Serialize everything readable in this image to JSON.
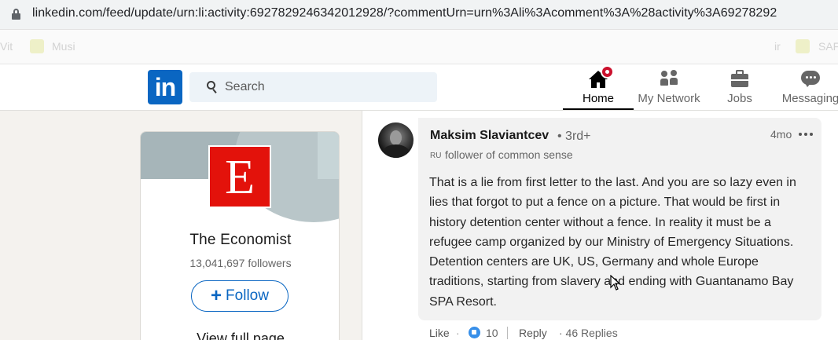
{
  "browser": {
    "url": "linkedin.com/feed/update/urn:li:activity:6927829246342012928/?commentUrn=urn%3Ali%3Acomment%3A%28activity%3A69278292"
  },
  "bookmarks": [
    "Vit",
    "Musi",
    "SAF",
    "ir"
  ],
  "header": {
    "logo": "in",
    "search_placeholder": "Search",
    "nav": [
      {
        "label": "Home"
      },
      {
        "label": "My Network"
      },
      {
        "label": "Jobs"
      },
      {
        "label": "Messaging"
      }
    ]
  },
  "company": {
    "logo_letter": "E",
    "name": "The Economist",
    "followers": "13,041,697 followers",
    "follow_label": "Follow",
    "view_page_label": "View full page"
  },
  "comment": {
    "author": "Maksim Slaviantcev",
    "degree": "• 3rd+",
    "flag": "RU",
    "headline": "follower of common sense",
    "time": "4mo",
    "text": "That is a lie from first letter to the last. And you are so lazy even in lies that forgot to put a fence on a picture. That would be first in history detention center without a fence. In reality it must be a refugee camp organized by our Ministry of Emergency Situations. Detention centers are UK, US, Germany and whole Europe traditions, starting from slavery and ending with Guantanamo Bay SPA Resort.",
    "actions": {
      "like_label": "Like",
      "dot1": "·",
      "like_count": "10",
      "reply_label": "Reply",
      "replies": "· 46 Replies"
    }
  },
  "colors": {
    "linkedin_blue": "#0a66c2",
    "economist_red": "#e3120b",
    "notification_red": "#cb112d"
  }
}
